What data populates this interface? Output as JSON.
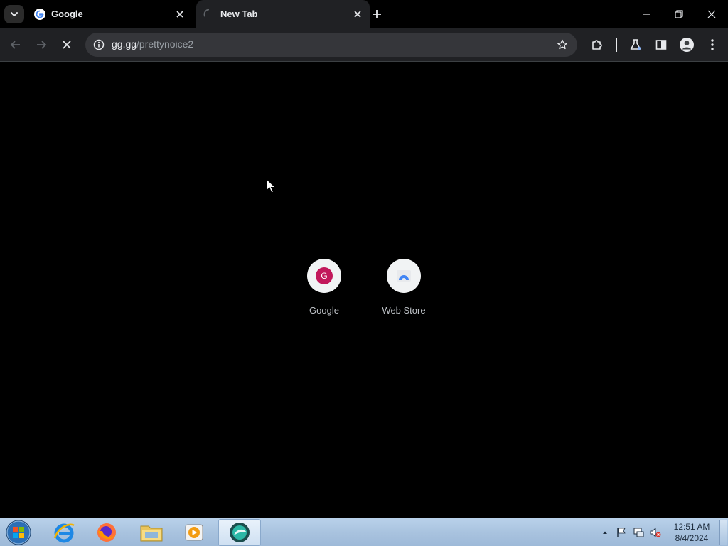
{
  "browser": {
    "tabs": [
      {
        "title": "Google",
        "favicon": "google-g-icon",
        "active": false
      },
      {
        "title": "New Tab",
        "favicon": "loading-spinner-icon",
        "active": true
      }
    ],
    "address_bar": {
      "url_host": "gg.gg",
      "url_path": "/prettynoice2",
      "site_info_icon": "info-icon"
    },
    "toolbar_icons": [
      "back-icon",
      "forward-icon",
      "stop-loading-icon",
      "bookmark-star-icon",
      "extensions-icon",
      "labs-flask-icon",
      "side-panel-icon",
      "profile-icon",
      "menu-icon"
    ],
    "window_controls": [
      "minimize-icon",
      "restore-icon",
      "close-icon"
    ]
  },
  "new_tab_page": {
    "shortcuts": [
      {
        "label": "Google",
        "icon": "G"
      },
      {
        "label": "Web Store",
        "icon": "web-store-icon"
      }
    ]
  },
  "taskbar": {
    "pinned": [
      "start-orb",
      "internet-explorer-icon",
      "firefox-icon",
      "file-explorer-icon",
      "media-player-icon",
      "browser-app-icon"
    ],
    "clock_time": "12:51 AM",
    "clock_date": "8/4/2024"
  },
  "colors": {
    "tab_active_bg": "#202124",
    "omnibox_bg": "#35363a",
    "text_primary": "#e8eaed",
    "text_secondary": "#9aa0a6",
    "google_avatar": "#c2185b"
  }
}
